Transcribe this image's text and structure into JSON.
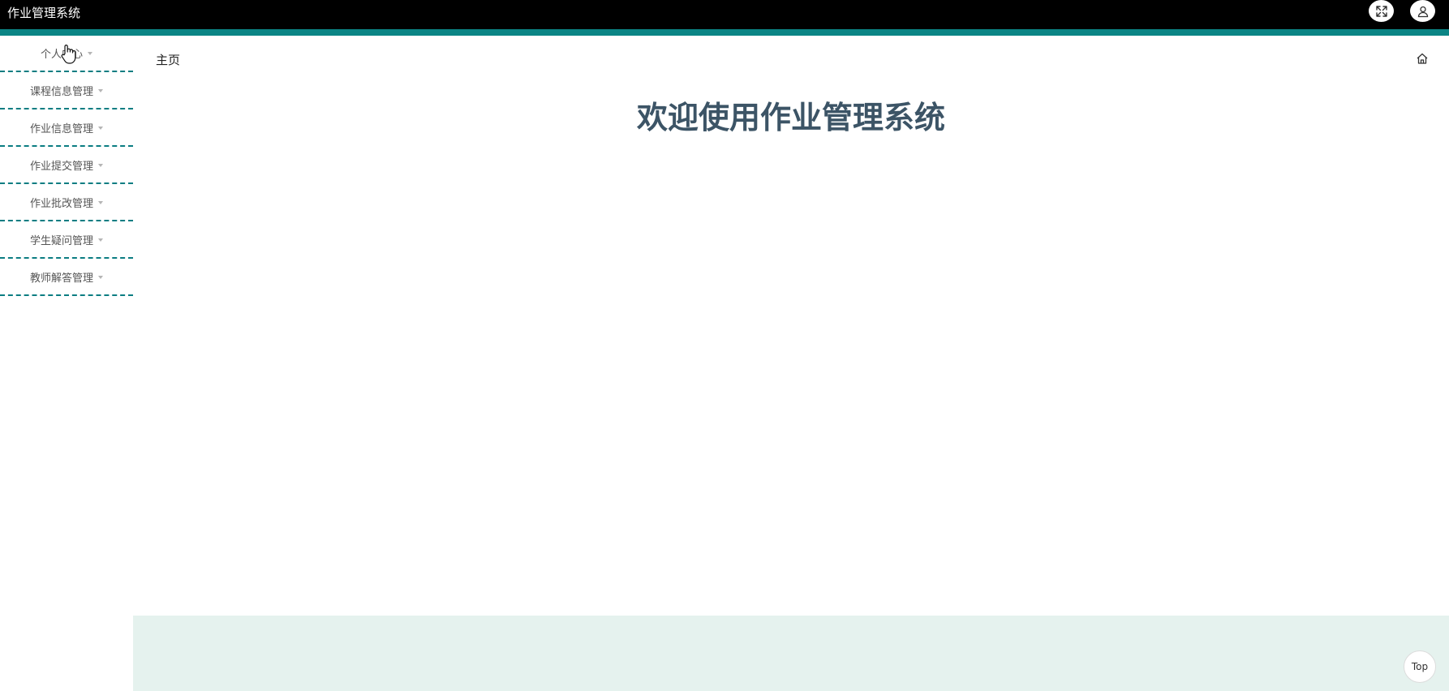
{
  "header": {
    "app_title": "作业管理系统",
    "icons": {
      "fullscreen": "fullscreen-icon",
      "user": "user-icon"
    }
  },
  "sidebar": {
    "items": [
      {
        "label": "个人中心"
      },
      {
        "label": "课程信息管理"
      },
      {
        "label": "作业信息管理"
      },
      {
        "label": "作业提交管理"
      },
      {
        "label": "作业批改管理"
      },
      {
        "label": "学生疑问管理"
      },
      {
        "label": "教师解答管理"
      }
    ]
  },
  "breadcrumb": {
    "current": "主页",
    "icon": "home-icon"
  },
  "main": {
    "welcome": "欢迎使用作业管理系统"
  },
  "footer": {
    "top_label": "Top"
  },
  "colors": {
    "topbar": "#000000",
    "accent_teal": "#0b8585",
    "title_text": "#3c5466",
    "footer_band": "#e5f2ee"
  }
}
